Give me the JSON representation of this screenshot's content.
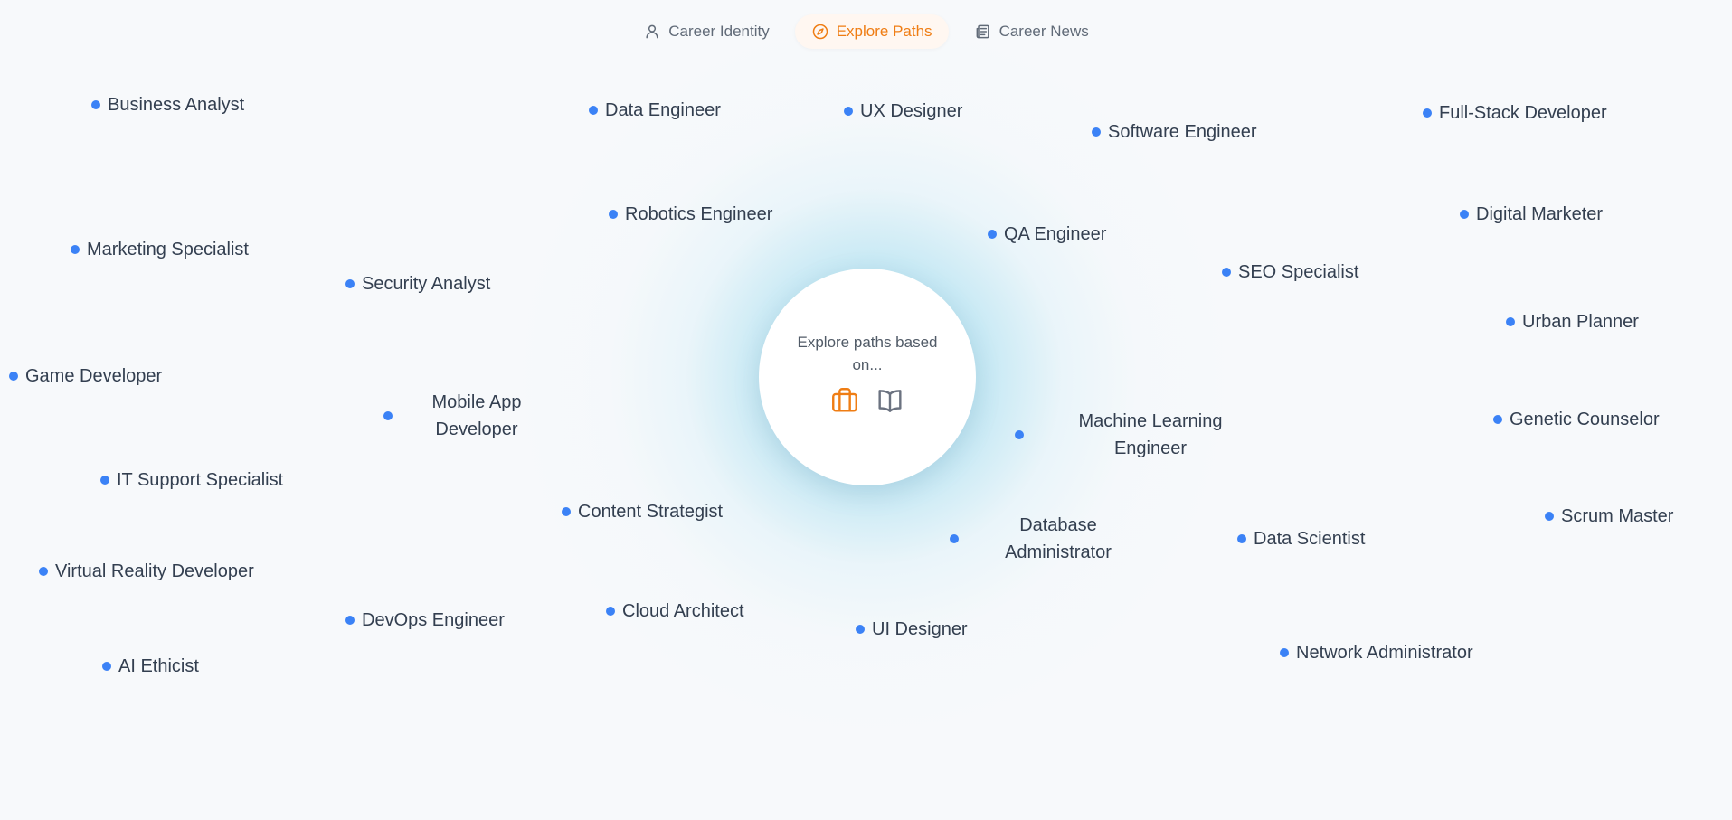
{
  "tabs": [
    {
      "label": "Career Identity",
      "icon": "person-icon",
      "active": false
    },
    {
      "label": "Explore Paths",
      "icon": "compass-icon",
      "active": true
    },
    {
      "label": "Career News",
      "icon": "newspaper-icon",
      "active": false
    }
  ],
  "center": {
    "text": "Explore paths based on...",
    "icons": [
      "briefcase-icon",
      "book-open-icon"
    ]
  },
  "colors": {
    "accent": "#ef7d14",
    "dot": "#3b82f6",
    "text": "#333f50",
    "background": "#f7f9fb"
  },
  "careers": [
    "Business Analyst",
    "Data Engineer",
    "UX Designer",
    "Software Engineer",
    "Full-Stack Developer",
    "Robotics Engineer",
    "QA Engineer",
    "Digital Marketer",
    "Marketing Specialist",
    "Security Analyst",
    "SEO Specialist",
    "Urban Planner",
    "Game Developer",
    "Mobile App Developer",
    "Machine Learning Engineer",
    "Genetic Counselor",
    "IT Support Specialist",
    "Content Strategist",
    "Database Administrator",
    "Data Scientist",
    "Scrum Master",
    "Virtual Reality Developer",
    "DevOps Engineer",
    "Cloud Architect",
    "UI Designer",
    "Network Administrator",
    "AI Ethicist"
  ]
}
